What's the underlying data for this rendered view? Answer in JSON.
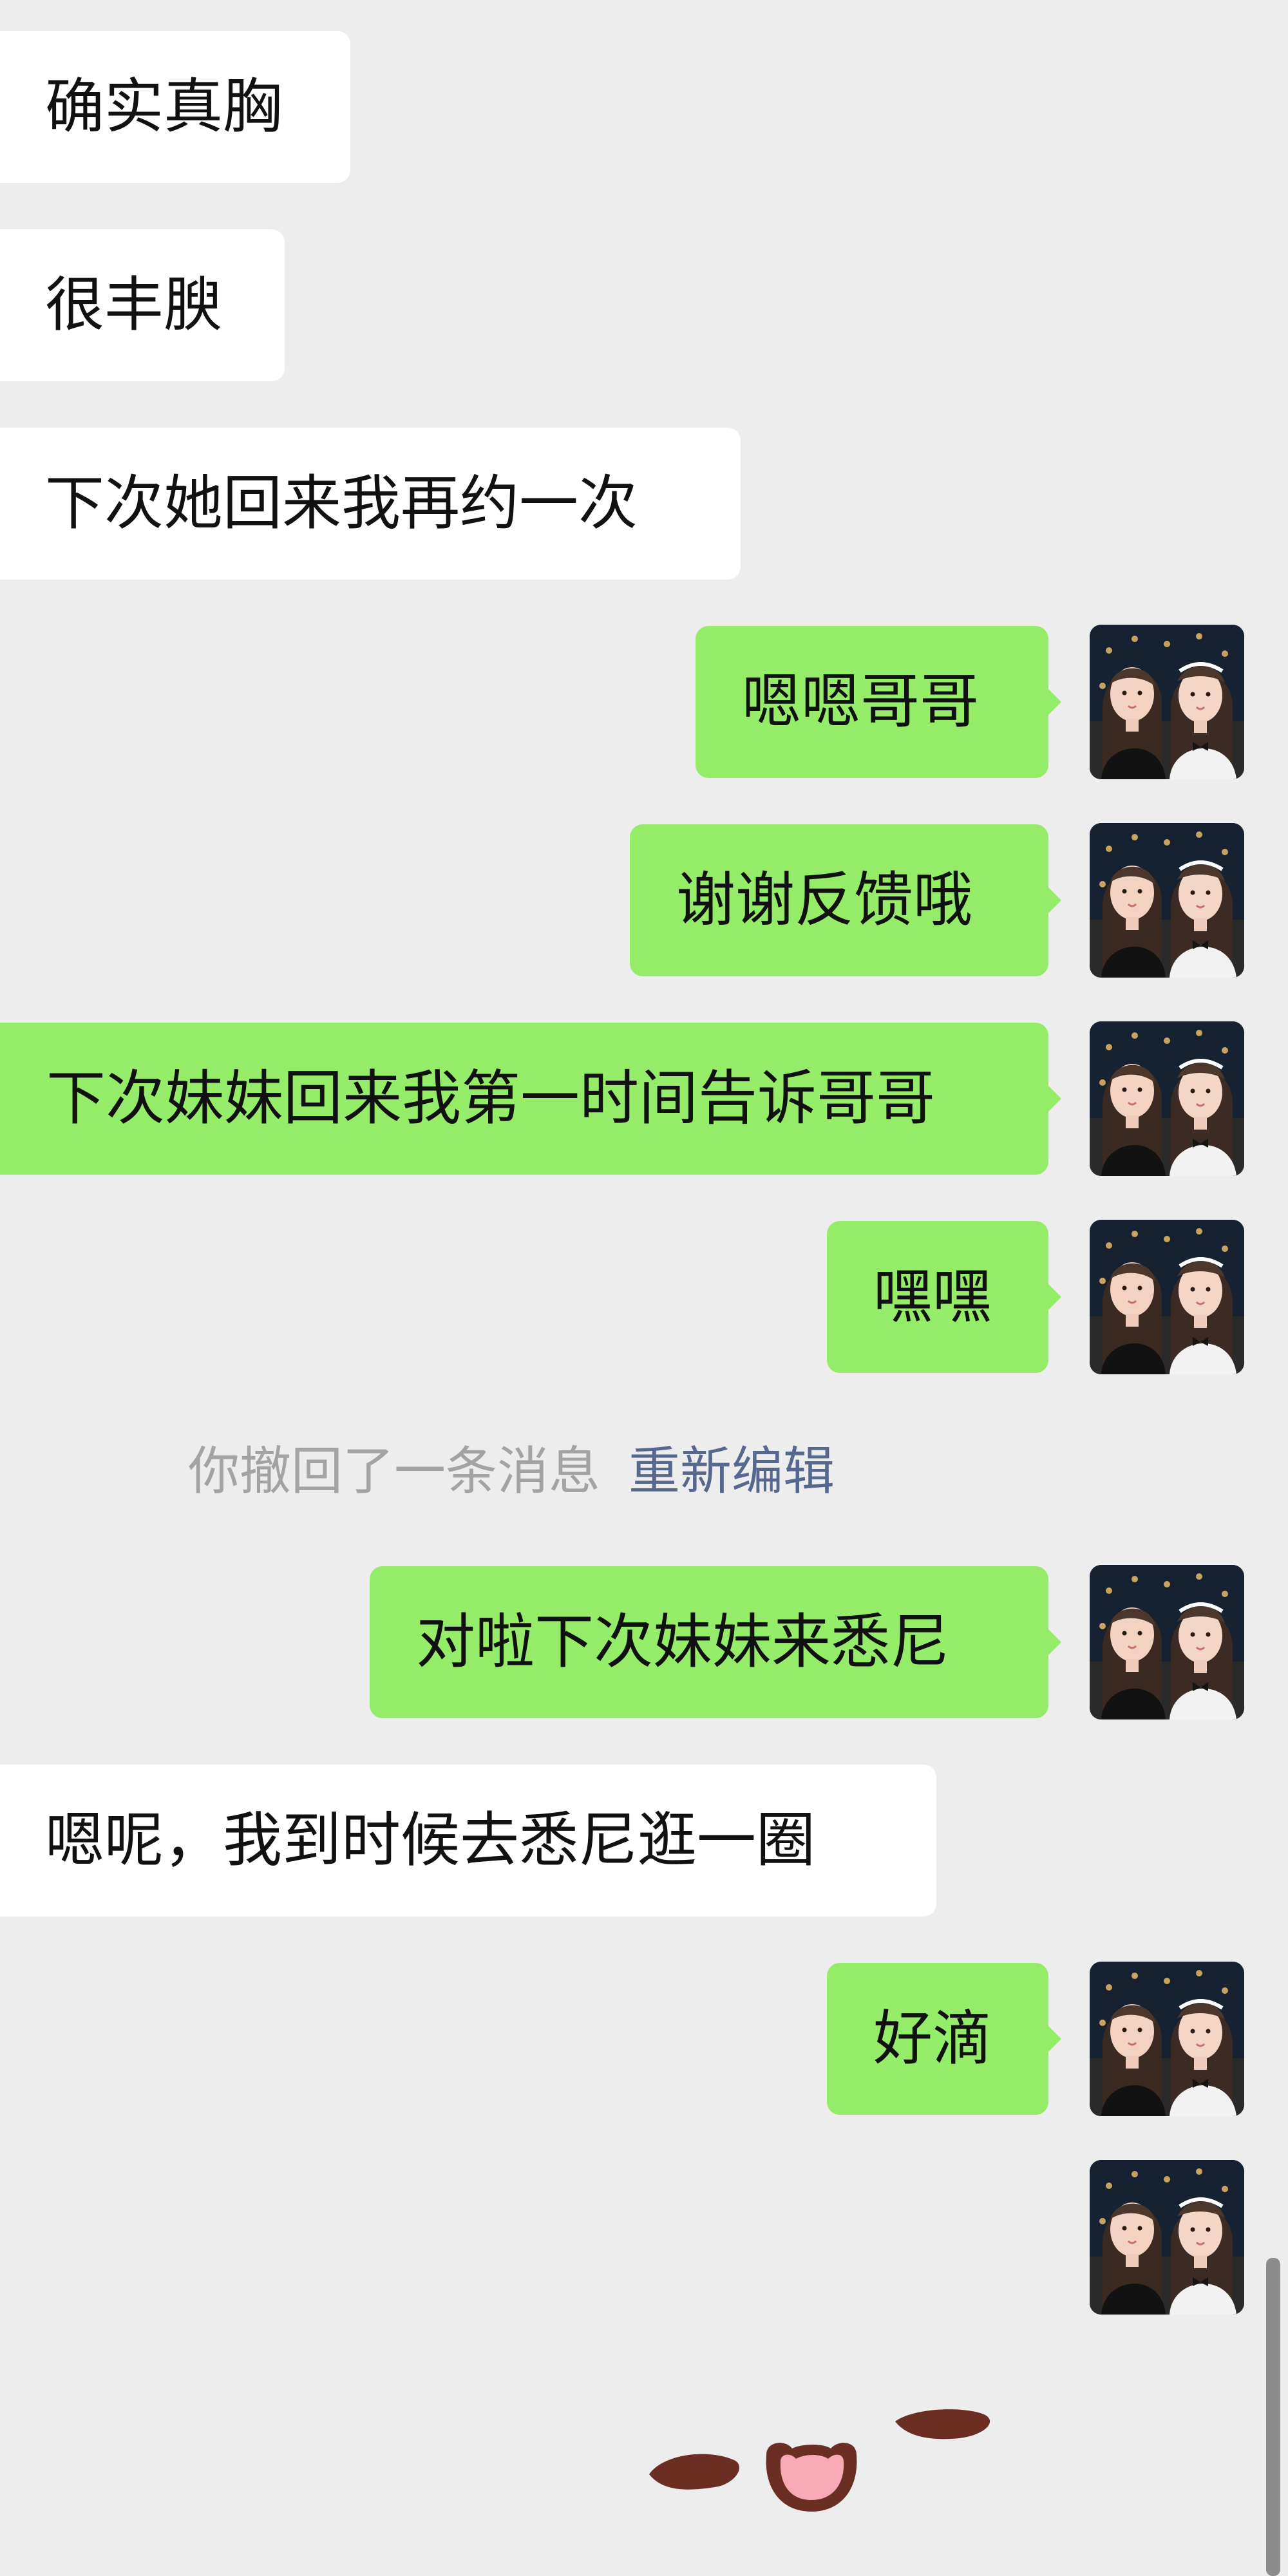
{
  "messages": [
    {
      "side": "in",
      "text": "确实真胸"
    },
    {
      "side": "in",
      "text": "很丰腴"
    },
    {
      "side": "in",
      "text": "下次她回来我再约一次"
    },
    {
      "side": "out",
      "text": "嗯嗯哥哥"
    },
    {
      "side": "out",
      "text": "谢谢反馈哦"
    },
    {
      "side": "out",
      "text": "下次妹妹回来我第一时间告诉哥哥"
    },
    {
      "side": "out",
      "text": "嘿嘿"
    },
    {
      "side": "system",
      "text": "你撤回了一条消息",
      "action": "重新编辑"
    },
    {
      "side": "out",
      "text": "对啦下次妹妹来悉尼"
    },
    {
      "side": "in",
      "text": "嗯呢，我到时候去悉尼逛一圈"
    },
    {
      "side": "out",
      "text": "好滴"
    },
    {
      "side": "out",
      "type": "sticker",
      "text": ""
    }
  ],
  "colors": {
    "background": "#ededed",
    "incoming_bubble": "#ffffff",
    "outgoing_bubble": "#95ec69",
    "system_text": "#a3a3a3",
    "link_text": "#57688f"
  },
  "icons": {
    "avatar": "user-avatar-photo",
    "sticker": "cute-face-sticker"
  }
}
